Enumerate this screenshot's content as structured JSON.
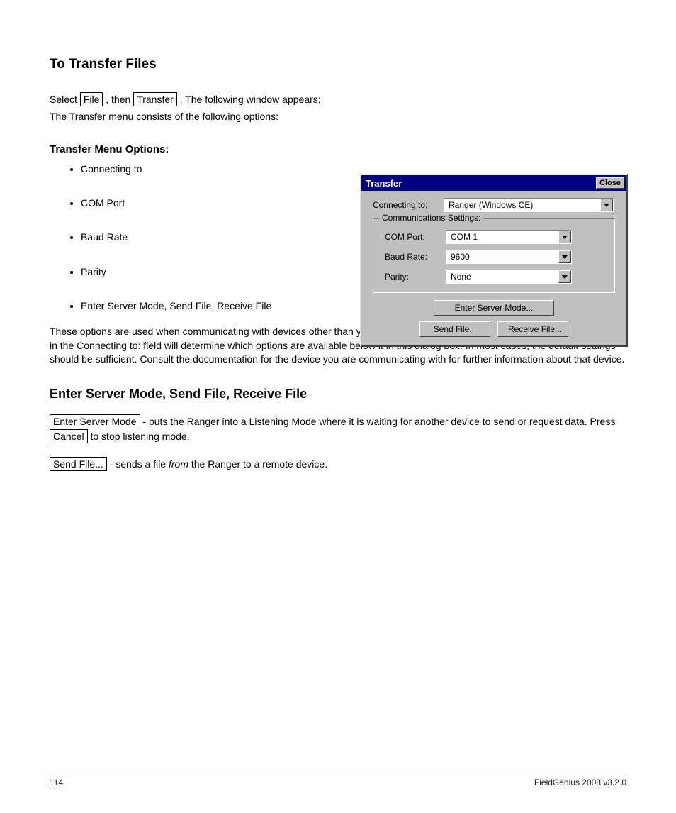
{
  "header": {
    "section_title": "To Transfer Files",
    "intro_1_pre": "Select ",
    "intro_1_mid": ", then ",
    "intro_1_post": " . The following window appears:",
    "btn_file": "File",
    "btn_transfer": "Transfer",
    "intro_2_pre": "The ",
    "intro_2_link": "Transfer",
    "intro_2_post": " menu consists of the following options:"
  },
  "menu_options": {
    "title": "Transfer Menu Options:",
    "items": [
      "Connecting to",
      "COM Port",
      "Baud Rate",
      "Parity",
      "Enter Server Mode, Send File, Receive File"
    ]
  },
  "paragraph": "These options are used when communicating with devices other than your PC, such as other brands of data collectors. Your choice in the Connecting to: field will determine which options are available below it in this dialog box. In most cases, the default settings should be sufficient. Consult the documentation for the device you are communicating with for further information about that device.",
  "buttons_section": {
    "title": "Enter Server Mode, Send File, Receive File",
    "rows": [
      {
        "btn": "Enter Server Mode",
        "desc_pre": " - puts the Ranger into a Listening Mode where it is waiting for another device to send or request data. Press ",
        "cancel": "Cancel",
        "desc_post": " to stop listening mode."
      },
      {
        "btn": "Send File...",
        "desc_pre": " - sends a file ",
        "italic": "from",
        "desc_post": " the Ranger to a remote device."
      }
    ]
  },
  "dialog": {
    "title": "Transfer",
    "close": "Close",
    "connecting_label": "Connecting to:",
    "connecting_value": "Ranger (Windows CE)",
    "group_title": "Communications Settings:",
    "com_label": "COM Port:",
    "com_value": "COM 1",
    "baud_label": "Baud Rate:",
    "baud_value": "9600",
    "parity_label": "Parity:",
    "parity_value": "None",
    "btn_server": "Enter Server Mode...",
    "btn_send": "Send File...",
    "btn_receive": "Receive File..."
  },
  "footer": {
    "left": "114",
    "right": "FieldGenius 2008 v3.2.0"
  }
}
